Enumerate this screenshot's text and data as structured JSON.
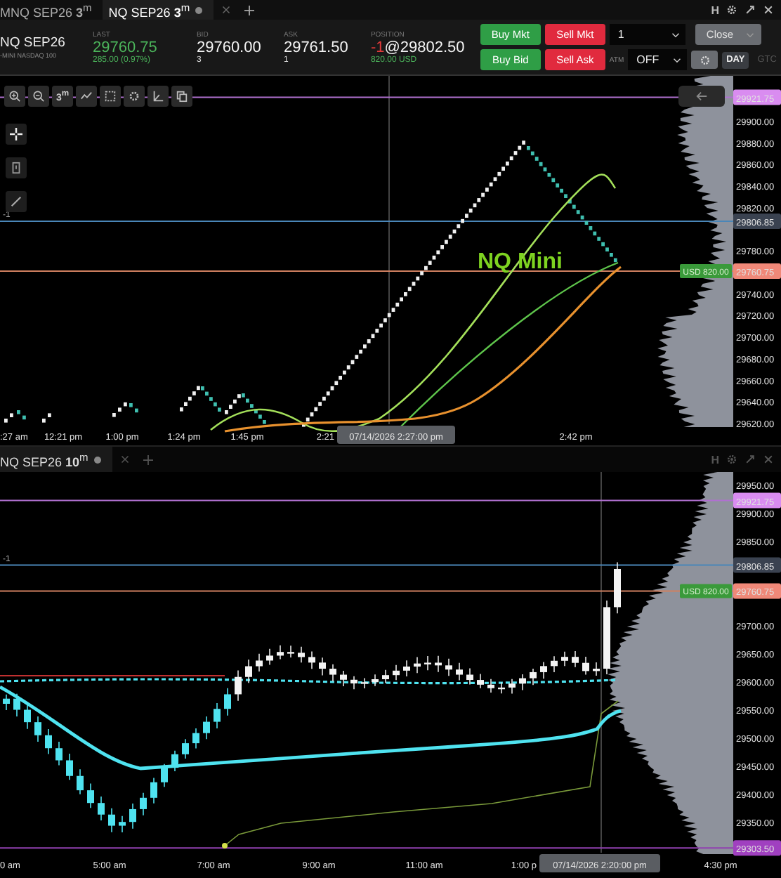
{
  "top_tabs": [
    {
      "label": "MNQ SEP26 **3**$^{m}$",
      "selected": false
    },
    {
      "label": "NQ SEP26 **3**$^{m}$",
      "selected": true
    }
  ],
  "window_controls": [
    {
      "kind": "text",
      "label": "H"
    },
    {
      "kind": "gear"
    },
    {
      "kind": "expand"
    },
    {
      "kind": "close"
    }
  ],
  "quote": {
    "symbol": "NQ SEP26",
    "description": "-MINI NASDAQ 100",
    "last": {
      "label": "LAST",
      "value": "29760.75",
      "change": "285.00 (0.97%)"
    },
    "bid": {
      "label": "BID",
      "value": "29760.00",
      "size": "3"
    },
    "ask": {
      "label": "ASK",
      "value": "29761.50",
      "size": "1"
    },
    "position": {
      "label": "POSITION",
      "qty": "-1",
      "price": "@29802.50",
      "pnl": "820.00 USD"
    }
  },
  "order_panel": {
    "buttons": [
      {
        "label": "Buy Mkt",
        "kind": "buy"
      },
      {
        "label": "Sell Mkt",
        "kind": "sell"
      },
      {
        "label": "Buy Bid",
        "kind": "buy"
      },
      {
        "label": "Sell Ask",
        "kind": "sell"
      }
    ],
    "quantity": "1",
    "close_label": "Close",
    "atm_label": "ATM",
    "atm_value": "OFF",
    "time_in_force": [
      {
        "label": "DAY",
        "selected": true
      },
      {
        "label": "GTC",
        "selected": false
      }
    ]
  },
  "panes": [
    {
      "kind": "renko",
      "toolbar": [
        {
          "kind": "zoom-in"
        },
        {
          "kind": "zoom-out"
        },
        {
          "kind": "interval",
          "label": "3$^{m}$"
        },
        {
          "kind": "line"
        },
        {
          "kind": "select"
        },
        {
          "kind": "gear"
        },
        {
          "kind": "axis"
        },
        {
          "kind": "copy"
        }
      ],
      "side_tools": [
        {
          "kind": "crosshair"
        },
        {
          "kind": "note"
        },
        {
          "kind": "pencil"
        }
      ],
      "position_side": "-1",
      "overlay_title": "NQ Mini",
      "price_labels": [
        "29900.00",
        "29880.00",
        "29860.00",
        "29840.00",
        "29820.00",
        "29780.00",
        "29740.00",
        "29720.00",
        "29700.00",
        "29680.00",
        "29660.00",
        "29640.00",
        "29620.00"
      ],
      "markers": [
        {
          "kind": "high",
          "price": "29921.75"
        },
        {
          "kind": "level",
          "price": "29806.85"
        },
        {
          "kind": "last",
          "price": "29760.75"
        }
      ],
      "position_tag": "USD 820.00",
      "time_labels": [
        ":27 am",
        "12:21 pm",
        "1:00 pm",
        "1:24 pm",
        "1:45 pm",
        "2:21",
        "2:42 pm"
      ],
      "crosshair_time": "07/14/2026 2:27:00 pm"
    },
    {
      "kind": "candles",
      "tab": {
        "label": "NQ SEP26 **10**$^{m}$",
        "selected": true
      },
      "window_controls": [
        {
          "kind": "text",
          "label": "H"
        },
        {
          "kind": "gear"
        },
        {
          "kind": "expand"
        },
        {
          "kind": "close"
        }
      ],
      "position_side": "-1",
      "price_labels": [
        "29950.00",
        "29900.00",
        "29850.00",
        "29700.00",
        "29650.00",
        "29600.00",
        "29550.00",
        "29500.00",
        "29450.00",
        "29400.00",
        "29350.00"
      ],
      "markers": [
        {
          "kind": "high",
          "price": "29921.75"
        },
        {
          "kind": "level",
          "price": "29806.85"
        },
        {
          "kind": "last",
          "price": "29760.75"
        },
        {
          "kind": "low",
          "price": "29303.50"
        }
      ],
      "position_tag": "USD 820.00",
      "time_labels": [
        "0 am",
        "5:00 am",
        "7:00 am",
        "9:00 am",
        "11:00 am",
        "1:00 p",
        "4:30 pm"
      ],
      "crosshair_time": "07/14/2026 2:20:00 pm"
    }
  ]
}
